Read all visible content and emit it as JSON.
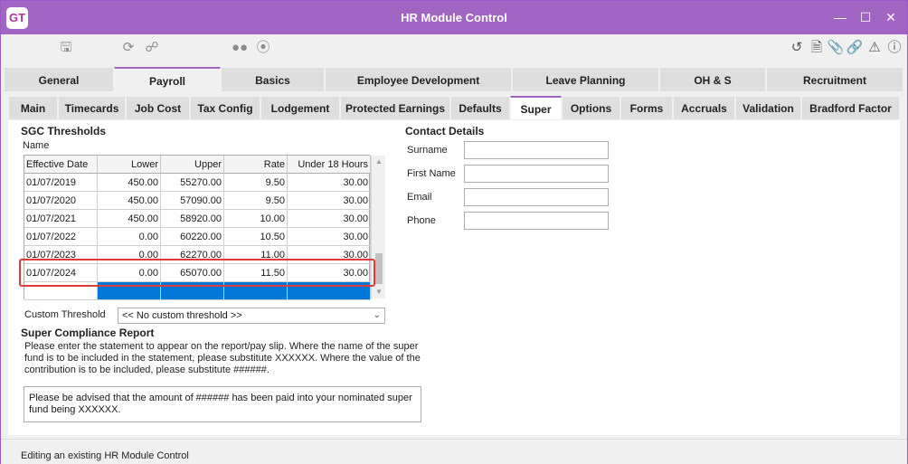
{
  "window": {
    "logo_text": "GT",
    "title": "HR Module Control",
    "accent_color": "#a166c4"
  },
  "toolbar": {
    "left_icons": [
      "save-icon",
      "refresh-icon",
      "network-icon",
      "binoculars-icon",
      "navigate-icon"
    ],
    "right_icons": [
      "back-icon",
      "document-icon",
      "attach-icon",
      "link-icon",
      "alert-icon",
      "help-icon"
    ]
  },
  "main_tabs": [
    "General",
    "Payroll",
    "Basics",
    "Employee Development",
    "Leave Planning",
    "OH & S",
    "Recruitment"
  ],
  "main_tab_active": "Payroll",
  "sub_tabs": [
    "Main",
    "Timecards",
    "Job Cost",
    "Tax Config",
    "Lodgement",
    "Protected Earnings",
    "Defaults",
    "Super",
    "Options",
    "Forms",
    "Accruals",
    "Validation",
    "Bradford Factor"
  ],
  "sub_tab_active": "Super",
  "sgc": {
    "heading": "SGC Thresholds",
    "name_label": "Name",
    "columns": [
      "Effective Date",
      "Lower",
      "Upper",
      "Rate",
      "Under 18 Hours"
    ],
    "rows": [
      [
        "01/07/2019",
        "450.00",
        "55270.00",
        "9.50",
        "30.00"
      ],
      [
        "01/07/2020",
        "450.00",
        "57090.00",
        "9.50",
        "30.00"
      ],
      [
        "01/07/2021",
        "450.00",
        "58920.00",
        "10.00",
        "30.00"
      ],
      [
        "01/07/2022",
        "0.00",
        "60220.00",
        "10.50",
        "30.00"
      ],
      [
        "01/07/2023",
        "0.00",
        "62270.00",
        "11.00",
        "30.00"
      ],
      [
        "01/07/2024",
        "0.00",
        "65070.00",
        "11.50",
        "30.00"
      ]
    ],
    "custom_threshold_label": "Custom Threshold",
    "custom_threshold_value": "<< No custom threshold >>"
  },
  "compliance": {
    "heading": "Super Compliance Report",
    "instructions": "Please enter the statement to appear on the report/pay slip.  Where the name of the super fund is to be included in the statement, please substitute XXXXXX.  Where the value of the contribution is to be included, please substitute ######.",
    "statement": "Please be advised that the amount of ###### has been paid into your nominated super fund being XXXXXX."
  },
  "contact": {
    "heading": "Contact Details",
    "fields": [
      "Surname",
      "First Name",
      "Email",
      "Phone"
    ]
  },
  "status_text": "Editing an existing HR Module Control",
  "colors": {
    "selection": "#0078d7",
    "highlight_border": "#e03a3a"
  }
}
